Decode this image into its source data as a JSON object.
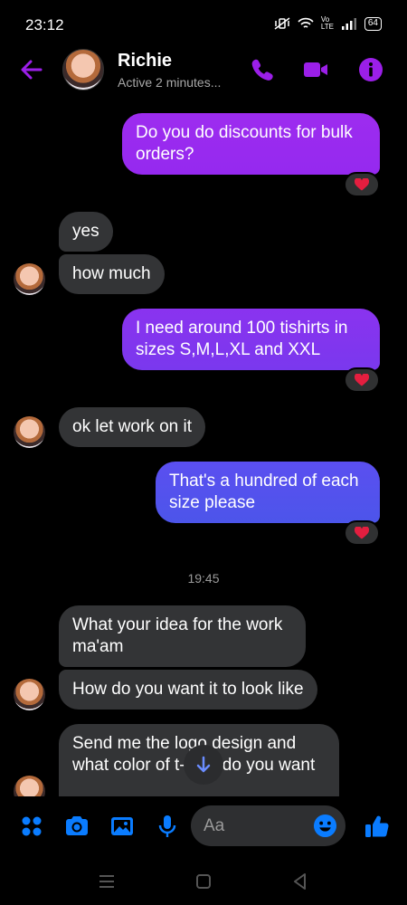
{
  "status_bar": {
    "time": "23:12",
    "network": "Vo LTE",
    "battery": "64"
  },
  "header": {
    "contact_name": "Richie",
    "contact_status": "Active 2 minutes..."
  },
  "colors": {
    "accent": "#9b1fe8",
    "outgoing_top": "#9d2cef",
    "outgoing_bottom": "#4c55ea",
    "incoming": "#333436",
    "heart": "#e41e3f"
  },
  "messages": [
    {
      "direction": "outgoing",
      "text": "Do you do discounts for bulk orders?",
      "reaction": "heart"
    },
    {
      "direction": "incoming",
      "text": "yes"
    },
    {
      "direction": "incoming",
      "text": "how much"
    },
    {
      "direction": "outgoing",
      "text": "I need around 100 tishirts in sizes S,M,L,XL and XXL",
      "reaction": "heart"
    },
    {
      "direction": "incoming",
      "text": "ok let work on it"
    },
    {
      "direction": "outgoing",
      "text": "That's a hundred of each size please",
      "reaction": "heart"
    },
    {
      "direction": "timestamp",
      "text": "19:45"
    },
    {
      "direction": "incoming",
      "text": "What your idea for the work ma'am"
    },
    {
      "direction": "incoming",
      "text": "How do you want it to look like"
    },
    {
      "direction": "incoming",
      "text": "Send me the logo design and what color of t-shirt do you want"
    }
  ],
  "composer": {
    "placeholder": "Aa"
  },
  "icons": [
    "back-arrow-icon",
    "phone-icon",
    "video-camera-icon",
    "info-icon",
    "apps-grid-icon",
    "camera-icon",
    "gallery-icon",
    "microphone-icon",
    "emoji-icon",
    "thumbs-up-icon",
    "arrow-down-icon",
    "heart-icon"
  ]
}
